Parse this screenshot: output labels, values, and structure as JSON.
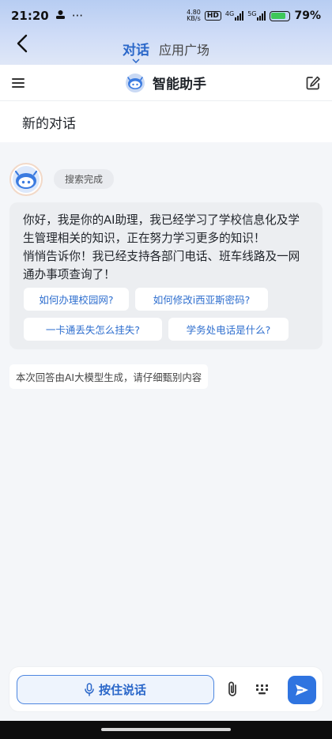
{
  "status_bar": {
    "time": "21:20",
    "dots": "···",
    "net_speed_value": "4.80",
    "net_speed_unit": "KB/s",
    "hd_badge": "HD",
    "net1": "4G",
    "net2": "5G",
    "battery": "79%"
  },
  "nav": {
    "tabs": [
      {
        "label": "对话",
        "active": true
      },
      {
        "label": "应用广场",
        "active": false
      }
    ]
  },
  "header": {
    "title": "智能助手"
  },
  "conversation": {
    "title": "新的对话",
    "status": "搜索完成",
    "answer": "你好，我是你的AI助理，我已经学习了学校信息化及学生管理相关的知识，正在努力学习更多的知识！\n悄悄告诉你！我已经支持各部门电话、班车线路及一网通办事项查询了！",
    "suggestions": [
      "如何办理校园网?",
      "如何修改i西亚斯密码?",
      "一卡通丢失怎么挂失?",
      "学务处电话是什么?"
    ],
    "disclaimer": "本次回答由AI大模型生成，请仔细甄别内容"
  },
  "input_bar": {
    "voice_label": "按住说话"
  },
  "colors": {
    "accent": "#2f74e0",
    "chip_text": "#2f6fcf",
    "bubble_bg": "#eceef1",
    "page_bg": "#f4f6f9"
  },
  "icons": [
    "back-arrow-icon",
    "menu-icon",
    "robot-logo-icon",
    "edit-icon",
    "mic-icon",
    "paperclip-icon",
    "keyboard-icon",
    "send-icon"
  ]
}
